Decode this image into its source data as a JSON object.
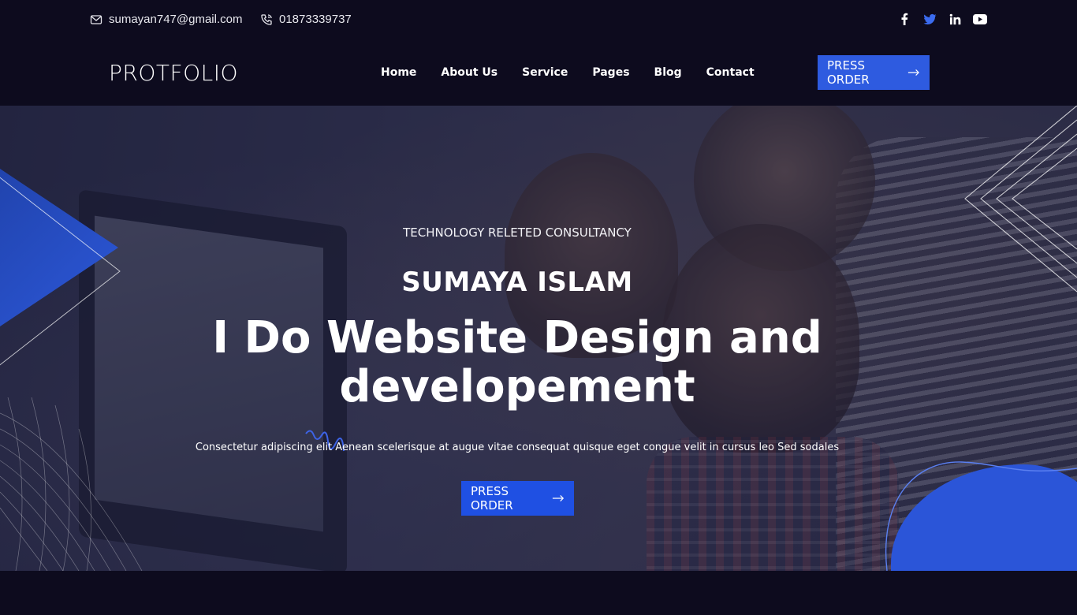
{
  "topbar": {
    "email": "sumayan747@gmail.com",
    "phone": "01873339737",
    "socials": [
      "facebook-icon",
      "twitter-icon",
      "linkedin-icon",
      "youtube-icon"
    ]
  },
  "nav": {
    "logo": "PROTFOLIO",
    "items": [
      "Home",
      "About Us",
      "Service",
      "Pages",
      "Blog",
      "Contact"
    ],
    "cta": "PRESS ORDER"
  },
  "hero": {
    "subtitle": "TECHNOLOGY RELETED CONSULTANCY",
    "name": "SUMAYA ISLAM",
    "headline_line1": "I Do Website Design and",
    "headline_line2": "developement",
    "description": "Consectetur adipiscing elit Aenean scelerisque at augue vitae consequat quisque eget congue velit in cursus leo Sed sodales",
    "cta": "PRESS ORDER"
  },
  "colors": {
    "background": "#0d0b1e",
    "accent": "#2e5be0",
    "twitter": "#3b6cf0"
  }
}
